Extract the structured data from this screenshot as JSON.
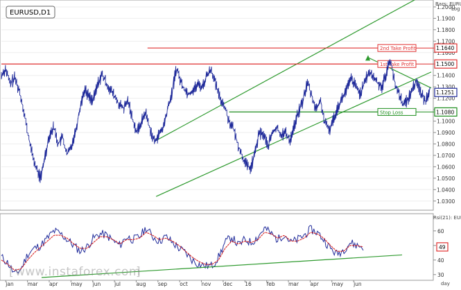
{
  "chart_data": [
    {
      "type": "line",
      "title": "EURUSD,D1",
      "corner_label": "Bars: EURU",
      "scale_label": "Log",
      "ylim": [
        1.025,
        1.203
      ],
      "y_ticks": [
        "1.2000",
        "1.1900",
        "1.1800",
        "1.1700",
        "1.1600",
        "1.1500",
        "1.1400",
        "1.1300",
        "1.1200",
        "1.1100",
        "1.1000",
        "1.0900",
        "1.0800",
        "1.0700",
        "1.0600",
        "1.0500",
        "1.0400",
        "1.0300"
      ],
      "x_ticks": [
        "jan",
        "mar",
        "apr",
        "may",
        "jun",
        "jul",
        "aug",
        "sep",
        "oct",
        "nov",
        "dec",
        "16",
        "feb",
        "mar",
        "apr",
        "may",
        "jun"
      ],
      "x_axis_unit": "day",
      "current_price": "1.1251",
      "levels": [
        {
          "label": "2nd Take Profit",
          "value": "1.1640",
          "color": "#e03030"
        },
        {
          "label": "1st Take Profit",
          "value": "1.1500",
          "color": "#e03030"
        },
        {
          "label": "Stop Loss",
          "value": "1.1080",
          "color": "#1a8c1a"
        }
      ],
      "channel_color": "#2e9a2e",
      "series_color": "#1f2a9a",
      "series": [
        {
          "values": [
            1.14,
            1.146,
            1.132,
            1.138,
            1.128,
            1.112,
            1.09,
            1.072,
            1.058,
            1.05,
            1.07,
            1.088,
            1.095,
            1.08,
            1.086,
            1.07,
            1.078,
            1.092,
            1.112,
            1.128,
            1.122,
            1.118,
            1.132,
            1.141,
            1.133,
            1.127,
            1.121,
            1.114,
            1.111,
            1.118,
            1.102,
            1.09,
            1.099,
            1.108,
            1.093,
            1.082,
            1.088,
            1.094,
            1.11,
            1.124,
            1.147,
            1.135,
            1.127,
            1.124,
            1.128,
            1.132,
            1.13,
            1.14,
            1.146,
            1.132,
            1.12,
            1.114,
            1.101,
            1.094,
            1.081,
            1.07,
            1.062,
            1.058,
            1.072,
            1.09,
            1.088,
            1.078,
            1.09,
            1.094,
            1.088,
            1.09,
            1.083,
            1.096,
            1.108,
            1.118,
            1.134,
            1.122,
            1.11,
            1.118,
            1.098,
            1.092,
            1.102,
            1.113,
            1.12,
            1.128,
            1.137,
            1.131,
            1.124,
            1.132,
            1.143,
            1.139,
            1.134,
            1.13,
            1.141,
            1.155,
            1.132,
            1.124,
            1.114,
            1.119,
            1.128,
            1.136,
            1.124,
            1.117,
            1.129
          ]
        }
      ]
    },
    {
      "type": "line",
      "title": "Rsi(21): EUR",
      "ylim": [
        28,
        68
      ],
      "y_ticks": [
        "60",
        "50",
        "40",
        "30"
      ],
      "current_value": "49",
      "series": [
        {
          "values": [
            42,
            38,
            30,
            34,
            44,
            48,
            50,
            55,
            60,
            58,
            54,
            50,
            46,
            49,
            55,
            58,
            57,
            53,
            50,
            56,
            54,
            56,
            62,
            56,
            53,
            56,
            52,
            48,
            45,
            40,
            37,
            36,
            36,
            42,
            52,
            56,
            50,
            54,
            52,
            56,
            62,
            58,
            54,
            58,
            52,
            54,
            57,
            61,
            59,
            54,
            48,
            44,
            47,
            52,
            50,
            49
          ]
        },
        {
          "values": [
            40,
            37,
            33,
            34,
            40,
            45,
            49,
            53,
            57,
            57,
            55,
            51,
            48,
            48,
            52,
            56,
            56,
            54,
            51,
            54,
            54,
            55,
            59,
            57,
            54,
            55,
            53,
            50,
            46,
            42,
            39,
            37,
            37,
            40,
            48,
            53,
            51,
            53,
            52,
            54,
            59,
            58,
            55,
            57,
            53,
            53,
            55,
            59,
            58,
            55,
            50,
            46,
            46,
            50,
            50,
            49
          ]
        }
      ]
    }
  ],
  "watermark": "www.instaforex.com"
}
